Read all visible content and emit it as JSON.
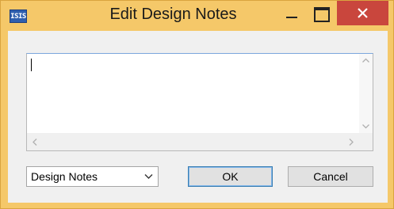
{
  "window": {
    "title": "Edit Design Notes",
    "app_icon_text": "ISIS"
  },
  "notes": {
    "value": ""
  },
  "category_select": {
    "selected": "Design Notes"
  },
  "buttons": {
    "ok_label": "OK",
    "cancel_label": "Cancel"
  },
  "colors": {
    "titlebar": "#f5c869",
    "close_button": "#c9463d",
    "client_bg": "#f0f0f0"
  },
  "icons": {
    "app": "isis-app-icon",
    "minimize": "minimize-icon",
    "maximize": "maximize-icon",
    "close": "close-icon",
    "scroll_up": "chevron-up-icon",
    "scroll_down": "chevron-down-icon",
    "scroll_left": "chevron-left-icon",
    "scroll_right": "chevron-right-icon",
    "dropdown": "chevron-down-icon"
  }
}
